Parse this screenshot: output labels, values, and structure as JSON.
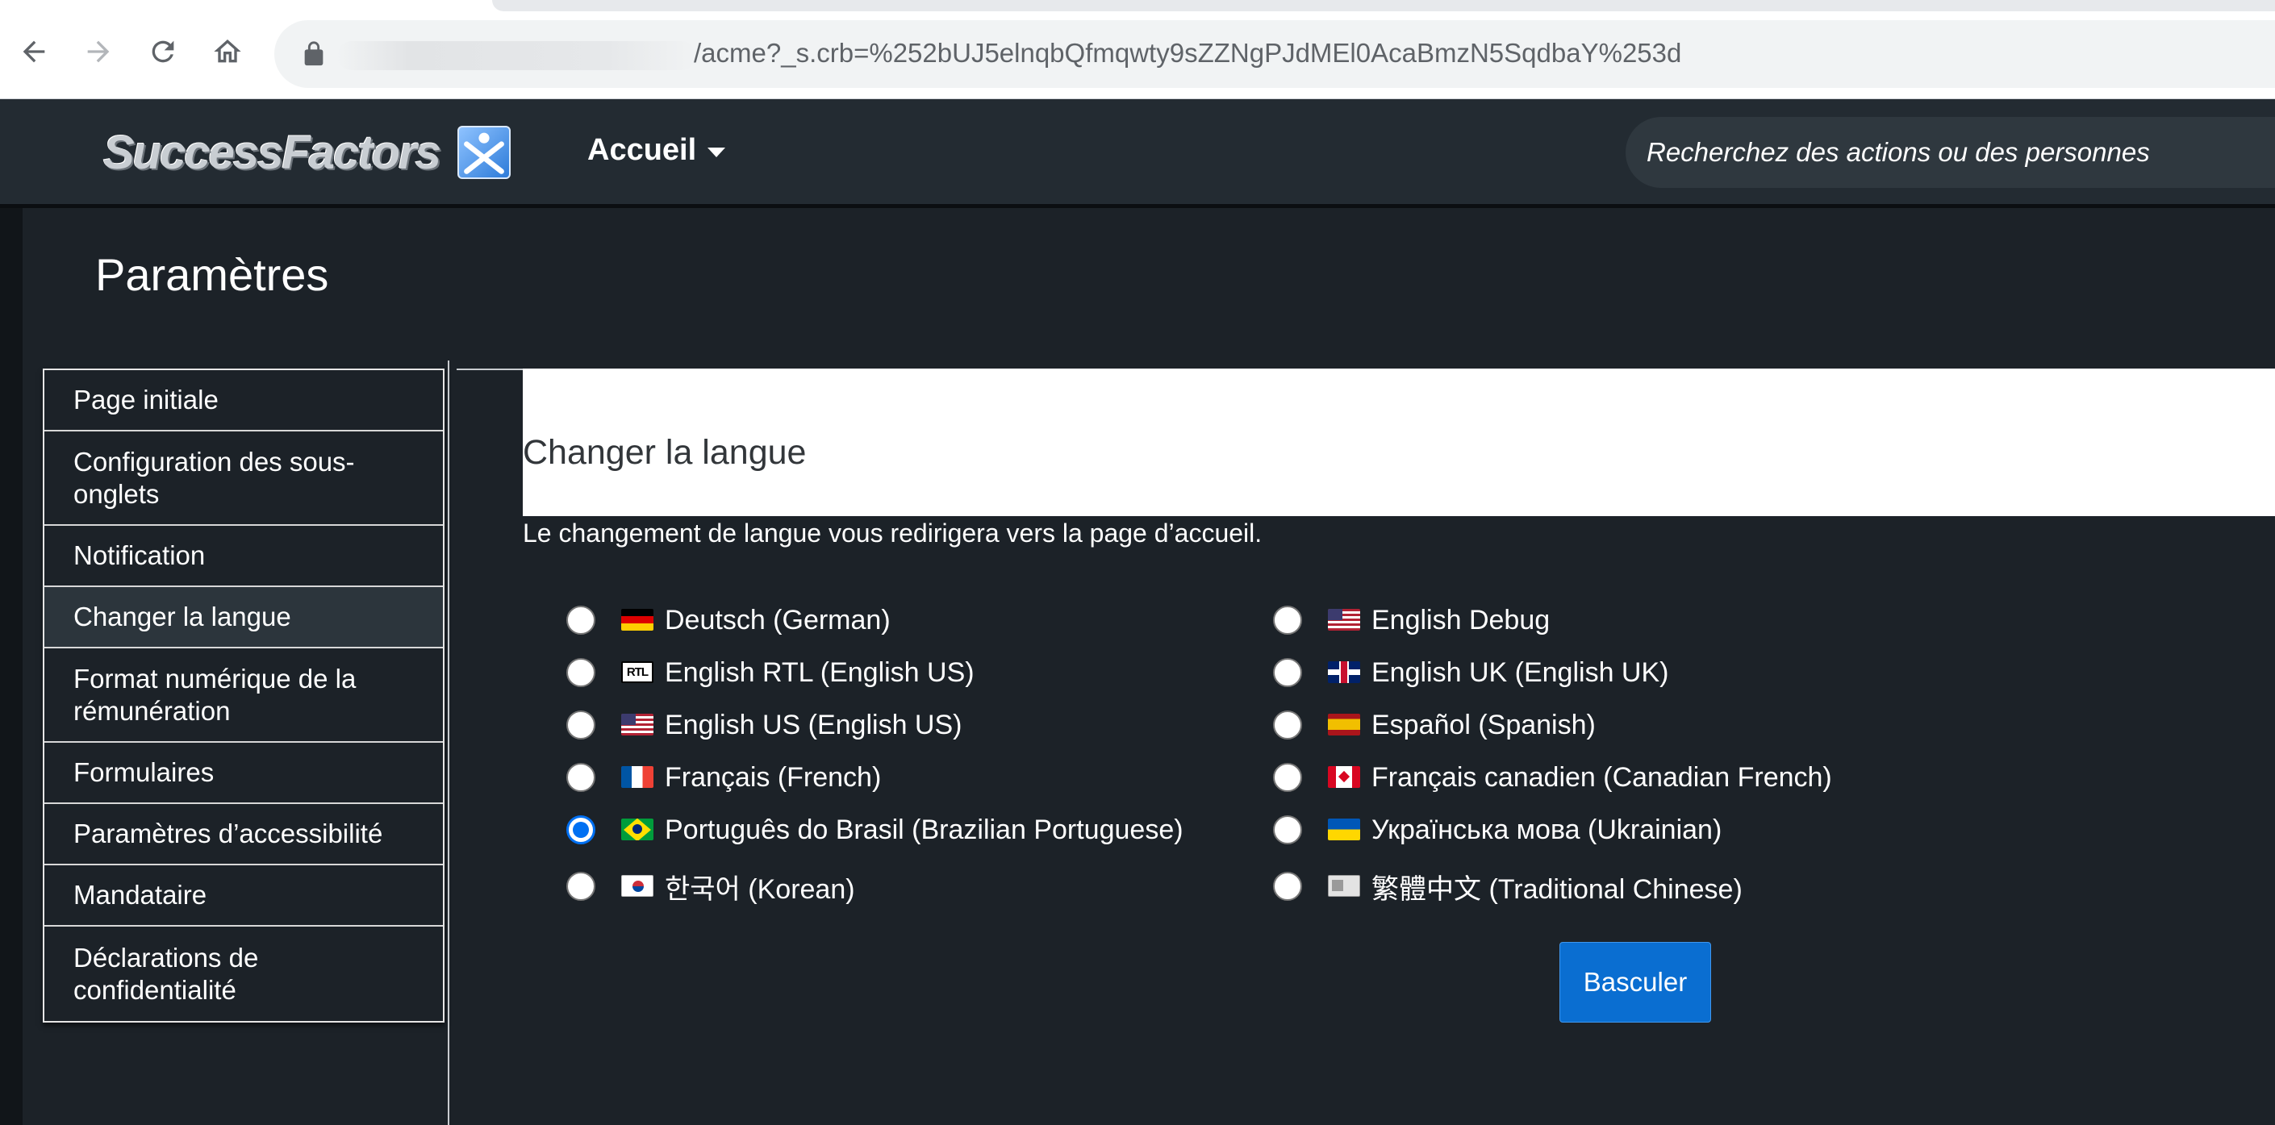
{
  "browser": {
    "url": "/acme?_s.crb=%252bUJ5elnqbQfmqwty9sZZNgPJdMEl0AcaBmzN5SqdbaY%253d"
  },
  "header": {
    "logo_text": "SuccessFactors",
    "nav_label": "Accueil",
    "search_placeholder": "Recherchez des actions ou des personnes"
  },
  "page": {
    "title": "Paramètres"
  },
  "sidebar": {
    "items": [
      {
        "label": "Page initiale"
      },
      {
        "label": "Configuration des sous-onglets"
      },
      {
        "label": "Notification"
      },
      {
        "label": "Changer la langue"
      },
      {
        "label": "Format numérique de la rémunération"
      },
      {
        "label": "Formulaires"
      },
      {
        "label": "Paramètres d’accessibilité"
      },
      {
        "label": "Mandataire"
      },
      {
        "label": "Déclarations de confidentialité"
      }
    ],
    "active_index": 3
  },
  "panel": {
    "title": "Changer la langue",
    "description": "Le changement de langue vous redirigera vers la page d’accueil.",
    "selected_language": "Português do Brasil (Brazilian Portuguese)",
    "left_languages": [
      {
        "label": "Deutsch (German)",
        "flag": "germany-flag-icon"
      },
      {
        "label": "English RTL (English US)",
        "flag": "rtl-flag-icon"
      },
      {
        "label": "English US (English US)",
        "flag": "usa-flag-icon"
      },
      {
        "label": "Français (French)",
        "flag": "france-flag-icon"
      },
      {
        "label": "Português do Brasil (Brazilian Portuguese)",
        "flag": "brazil-flag-icon"
      },
      {
        "label": "한국어 (Korean)",
        "flag": "korea-flag-icon"
      }
    ],
    "right_languages": [
      {
        "label": "English Debug",
        "flag": "usa-flag-icon"
      },
      {
        "label": "English UK (English UK)",
        "flag": "uk-flag-icon"
      },
      {
        "label": "Español (Spanish)",
        "flag": "spain-flag-icon"
      },
      {
        "label": "Français canadien (Canadian French)",
        "flag": "canada-flag-icon"
      },
      {
        "label": "Українська мова (Ukrainian)",
        "flag": "ukraine-flag-icon"
      },
      {
        "label": "繁體中文 (Traditional Chinese)",
        "flag": "taiwan-flag-icon"
      }
    ],
    "switch_button_label": "Basculer"
  },
  "colors": {
    "page_background": "#1c2228",
    "header_background": "#232b32",
    "accent": "#0a6ed1"
  }
}
